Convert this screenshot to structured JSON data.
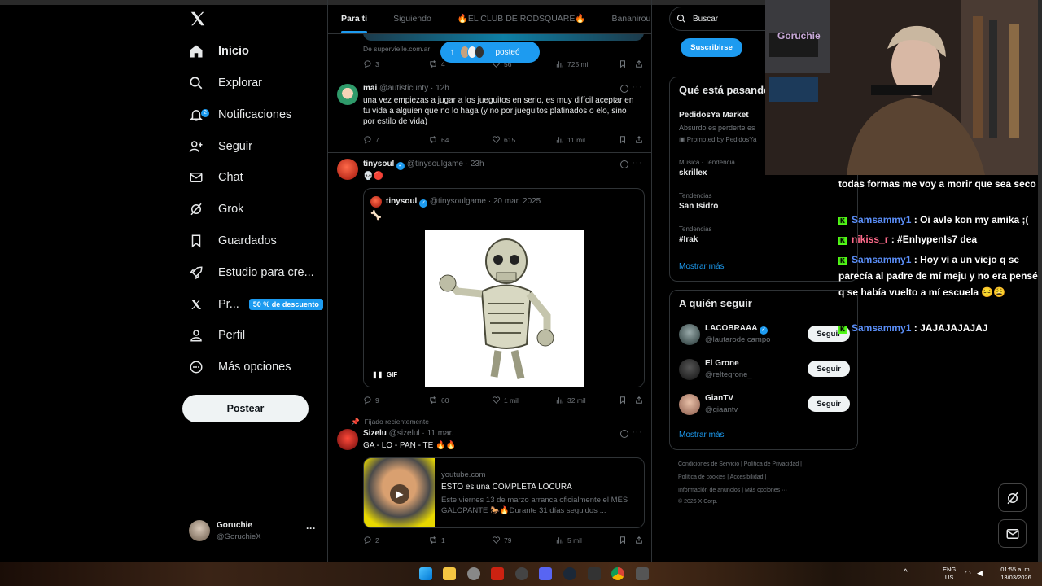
{
  "nav": {
    "items": [
      {
        "label": "Inicio",
        "icon": "home-icon"
      },
      {
        "label": "Explorar",
        "icon": "search-icon"
      },
      {
        "label": "Notificaciones",
        "icon": "bell-icon",
        "badge": "2"
      },
      {
        "label": "Seguir",
        "icon": "person-add-icon"
      },
      {
        "label": "Chat",
        "icon": "envelope-icon"
      },
      {
        "label": "Grok",
        "icon": "grok-icon"
      },
      {
        "label": "Guardados",
        "icon": "bookmark-icon"
      },
      {
        "label": "Estudio para cre...",
        "icon": "rocket-icon"
      },
      {
        "label": "Pr...",
        "icon": "x-logo-icon",
        "promo": "50 % de descuento"
      },
      {
        "label": "Perfil",
        "icon": "person-icon"
      },
      {
        "label": "Más opciones",
        "icon": "more-circle-icon"
      }
    ],
    "post_button": "Postear",
    "profile": {
      "name": "Goruchie",
      "handle": "@GoruchieX",
      "more": "···"
    }
  },
  "feed": {
    "tabs": [
      "Para ti",
      "Siguiendo",
      "🔥EL CLUB DE RODSQUARE🔥",
      "Bananirou"
    ],
    "posted_pill": "posteó",
    "ad_tweet": {
      "source": "De supervielle.com.ar",
      "replies": "3",
      "retweets": "4",
      "likes": "56",
      "views": "725 mil"
    },
    "tweets": [
      {
        "name": "mai",
        "handle": "@autisticunty",
        "time": "· 12h",
        "text": "una vez empiezas a jugar a los jueguitos en serio, es muy difícil aceptar en tu vida a alguien que no lo haga (y no por jueguitos platinados o elo, sino por estilo de vida)",
        "replies": "7",
        "retweets": "64",
        "likes": "615",
        "views": "11 mil"
      },
      {
        "name": "tinysoul",
        "handle": "@tinysoulgame",
        "time": "· 23h",
        "text": "💀🔴",
        "quote": {
          "name": "tinysoul",
          "handle": "@tinysoulgame",
          "time": "· 20 mar. 2025",
          "text": "🦴",
          "gif": "GIF"
        },
        "replies": "9",
        "retweets": "60",
        "likes": "1 mil",
        "views": "32 mil"
      },
      {
        "pinned": "Fijado recientemente",
        "name": "Sizelu",
        "handle": "@sizelul",
        "time": "· 11 mar.",
        "text": "GA - LO - PAN - TE 🔥🔥",
        "card": {
          "domain": "youtube.com",
          "title": "ESTO es una COMPLETA LOCURA",
          "desc": "Este viernes 13 de marzo arranca oficialmente el MES GALOPANTE 🐎🔥Durante 31 días seguidos ..."
        },
        "replies": "2",
        "retweets": "1",
        "likes": "79",
        "views": "5 mil"
      }
    ]
  },
  "right": {
    "search_placeholder": "Buscar",
    "subscribe": "Suscribirse",
    "trends_title": "Qué está pasando",
    "promo_trend": {
      "name": "PedidosYa Market",
      "desc": "Absurdo es perderte es",
      "promoted": "Promoted by PedidosYa"
    },
    "trends": [
      {
        "cat": "Música · Tendencia",
        "name": "skrillex"
      },
      {
        "cat": "Tendencias",
        "name": "San Isidro"
      },
      {
        "cat": "Tendencias",
        "name": "#Irak"
      }
    ],
    "show_more": "Mostrar más",
    "follow_title": "A quién seguir",
    "follow": [
      {
        "name": "LACOBRAAA",
        "handle": "@lautarodeIcampo",
        "btn": "Seguir",
        "verified": true
      },
      {
        "name": "El Grone",
        "handle": "@reltegrone_",
        "btn": "Seguir"
      },
      {
        "name": "GianTV",
        "handle": "@giaantv",
        "btn": "Seguir"
      }
    ],
    "footer": [
      "Condiciones de Servicio  |  Política de Privacidad  |",
      "Política de cookies  |  Accesibilidad  |",
      "Información de anuncios  |  Más opciones ···",
      "© 2026 X Corp."
    ]
  },
  "stream": {
    "cam_label": "Goruchie",
    "chat": [
      {
        "user": "",
        "msg": "todas formas me voy a morir que sea seco"
      },
      {
        "user": "Samsammy1",
        "msg": ": Oi avle kon my amika ;(",
        "color": "#5b8ff9"
      },
      {
        "user": "nikiss_r",
        "msg": ": #EnhypenIs7 dea",
        "color": "#ff6b8b"
      },
      {
        "user": "Samsammy1",
        "msg": ": Hoy vi a un viejo q se parecía al padre de mí meju y no era pensé q se había vuelto a mí escuela 😔😩",
        "color": "#5b8ff9"
      },
      {
        "user": "Samsammy1",
        "msg": ": JAJAJAJAJAJ",
        "color": "#5b8ff9"
      }
    ]
  },
  "taskbar": {
    "lang": "ENG",
    "region": "US",
    "time": "01:55 a. m.",
    "date": "13/03/2026"
  }
}
